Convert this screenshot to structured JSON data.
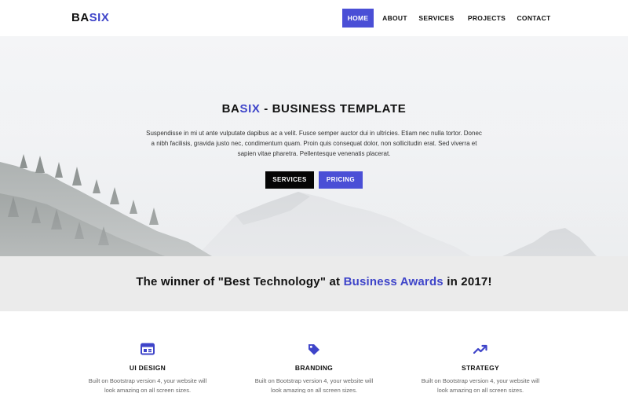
{
  "brand": {
    "part1": "BA",
    "part2": "SIX"
  },
  "nav": [
    {
      "label": "HOME",
      "active": true
    },
    {
      "label": "ABOUT",
      "active": false
    },
    {
      "label": "SERVICES",
      "active": false
    },
    {
      "label": "PROJECTS",
      "active": false
    },
    {
      "label": "CONTACT",
      "active": false
    }
  ],
  "hero": {
    "title_accent_prefix": "BA",
    "title_accent": "SIX",
    "title_rest": " - BUSINESS TEMPLATE",
    "text": "Suspendisse in mi ut ante vulputate dapibus ac a velit. Fusce semper auctor dui in ultricies. Etiam nec nulla tortor. Donec a nibh facilisis, gravida justo nec, condimentum quam. Proin quis consequat dolor, non sollicitudin erat. Sed viverra et sapien vitae pharetra. Pellentesque venenatis placerat.",
    "btn_primary": "SERVICES",
    "btn_secondary": "PRICING"
  },
  "award": {
    "before": "The winner of \"Best Technology\" at ",
    "accent": "Business Awards",
    "after": " in 2017!"
  },
  "features": [
    {
      "icon": "browser-window-icon",
      "title": "UI DESIGN",
      "text": "Built on Bootstrap version 4, your website will look amazing on all screen sizes."
    },
    {
      "icon": "price-tag-icon",
      "title": "BRANDING",
      "text": "Built on Bootstrap version 4, your website will look amazing on all screen sizes."
    },
    {
      "icon": "trending-up-icon",
      "title": "STRATEGY",
      "text": "Built on Bootstrap version 4, your website will look amazing on all screen sizes."
    }
  ],
  "colors": {
    "accent": "#4a4fd6",
    "accent_text": "#3e44c9",
    "dark": "#050505",
    "band": "#ebebeb"
  }
}
